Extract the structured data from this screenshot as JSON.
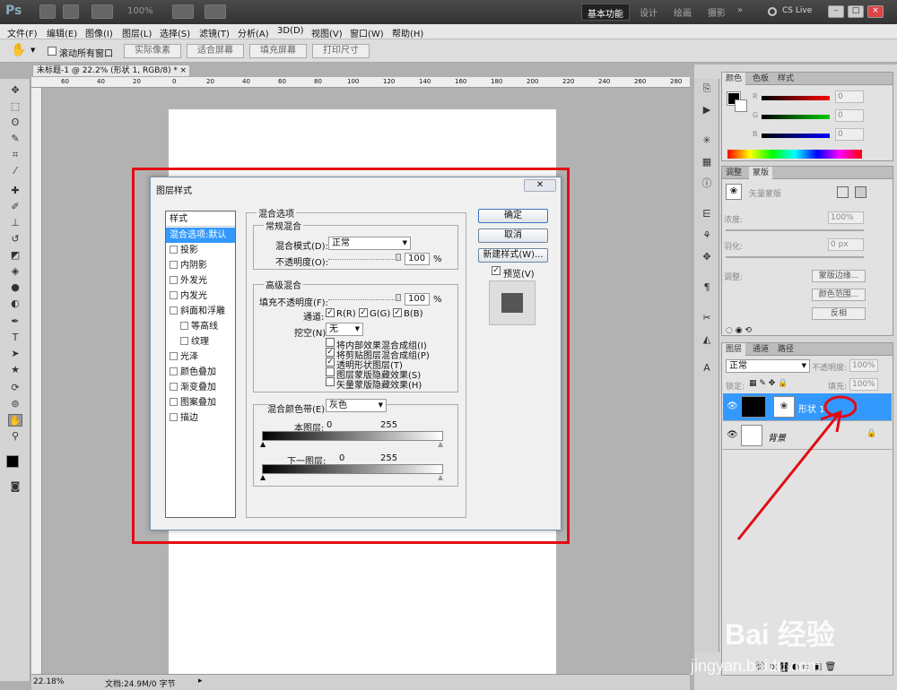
{
  "appbar": {
    "logo": "Ps",
    "zoom": "100%",
    "workspaces": [
      "基本功能",
      "设计",
      "绘画",
      "摄影"
    ],
    "more": "»",
    "cslive": "CS Live"
  },
  "menu": [
    "文件(F)",
    "编辑(E)",
    "图像(I)",
    "图层(L)",
    "选择(S)",
    "滤镜(T)",
    "分析(A)",
    "3D(D)",
    "视图(V)",
    "窗口(W)",
    "帮助(H)"
  ],
  "options": {
    "scroll_all": "滚动所有窗口",
    "buttons": [
      "实际像素",
      "适合屏幕",
      "填充屏幕",
      "打印尺寸"
    ]
  },
  "document": {
    "tab": "未标题-1 @ 22.2% (形状 1, RGB/8) *",
    "ruler_h": [
      "60",
      "40",
      "20",
      "0",
      "20",
      "40",
      "60",
      "80",
      "100",
      "120",
      "140",
      "160",
      "180",
      "200",
      "220",
      "240",
      "260",
      "280"
    ],
    "zoom_status": "22.18%",
    "doc_status": "文档:24.9M/0 字节"
  },
  "dialog": {
    "title": "图层样式",
    "styles_header": "样式",
    "styles": [
      {
        "label": "混合选项:默认",
        "selected": true,
        "checkbox": false
      },
      {
        "label": "投影",
        "checkbox": true
      },
      {
        "label": "内阴影",
        "checkbox": true
      },
      {
        "label": "外发光",
        "checkbox": true
      },
      {
        "label": "内发光",
        "checkbox": true
      },
      {
        "label": "斜面和浮雕",
        "checkbox": true
      },
      {
        "label": "等高线",
        "checkbox": true,
        "indent": true
      },
      {
        "label": "纹理",
        "checkbox": true,
        "indent": true
      },
      {
        "label": "光泽",
        "checkbox": true
      },
      {
        "label": "颜色叠加",
        "checkbox": true
      },
      {
        "label": "渐变叠加",
        "checkbox": true
      },
      {
        "label": "图案叠加",
        "checkbox": true
      },
      {
        "label": "描边",
        "checkbox": true
      }
    ],
    "blend_options": "混合选项",
    "general": "常规混合",
    "blend_mode_label": "混合模式(D):",
    "blend_mode_value": "正常",
    "opacity_label": "不透明度(O):",
    "opacity_value": "100",
    "percent": "%",
    "advanced": "高级混合",
    "fill_opacity_label": "填充不透明度(F):",
    "fill_opacity_value": "100",
    "channels_label": "通道:",
    "ch_r": "R(R)",
    "ch_g": "G(G)",
    "ch_b": "B(B)",
    "knockout_label": "挖空(N):",
    "knockout_value": "无",
    "adv_checks": [
      {
        "label": "将内部效果混合成组(I)",
        "checked": false
      },
      {
        "label": "将剪贴图层混合成组(P)",
        "checked": true
      },
      {
        "label": "透明形状图层(T)",
        "checked": true
      },
      {
        "label": "图层蒙版隐藏效果(S)",
        "checked": false
      },
      {
        "label": "矢量蒙版隐藏效果(H)",
        "checked": false
      }
    ],
    "blend_if_label": "混合颜色带(E):",
    "blend_if_value": "灰色",
    "this_layer": "本图层:",
    "underlying": "下一图层:",
    "v0": "0",
    "v255": "255",
    "btn_ok": "确定",
    "btn_cancel": "取消",
    "btn_new_style": "新建样式(W)...",
    "preview": "预览(V)"
  },
  "color_panel": {
    "tabs": [
      "颜色",
      "色板",
      "样式"
    ],
    "r_label": "R",
    "g_label": "G",
    "b_label": "B",
    "r": "0",
    "g": "0",
    "b": "0"
  },
  "adjust_panel": {
    "tabs": [
      "调整",
      "蒙版"
    ],
    "mask_label": "矢量蒙版",
    "density": "浓度:",
    "density_value": "100%",
    "feather": "羽化:",
    "feather_value": "0 px",
    "refine": "调整:",
    "btn_edge": "蒙版边缘...",
    "btn_color_range": "颜色范围...",
    "btn_invert": "反相"
  },
  "layers_panel": {
    "tabs": [
      "图层",
      "通道",
      "路径"
    ],
    "mode": "正常",
    "opacity_label": "不透明度:",
    "opacity": "100%",
    "lock_label": "锁定:",
    "fill_label": "填充:",
    "fill": "100%",
    "layers": [
      {
        "name": "形状 1",
        "selected": true
      },
      {
        "name": "背景",
        "selected": false
      }
    ]
  },
  "watermark": {
    "brand": "Bai 经验",
    "url": "jingyan.baidu.com"
  }
}
